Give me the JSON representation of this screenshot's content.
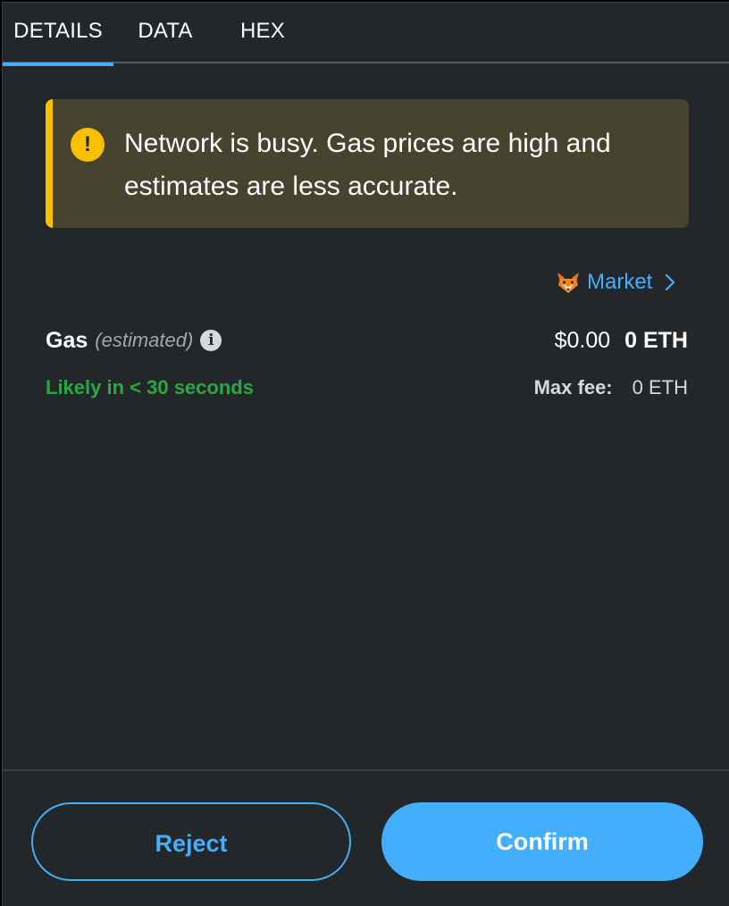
{
  "tabs": [
    {
      "label": "DETAILS",
      "active": true
    },
    {
      "label": "DATA",
      "active": false
    },
    {
      "label": "HEX",
      "active": false
    }
  ],
  "warning": {
    "icon": "exclamation-icon",
    "icon_glyph": "!",
    "text": "Network is busy. Gas prices are high and estimates are less accurate."
  },
  "market": {
    "icon": "fox-icon",
    "label": "Market"
  },
  "gas": {
    "label": "Gas",
    "sub_label": "(estimated)",
    "info_glyph": "i",
    "fiat": "$0.00",
    "eth": "0 ETH",
    "likely": "Likely in < 30 seconds",
    "max_fee_label": "Max fee:",
    "max_fee_value": "0 ETH"
  },
  "footer": {
    "reject_label": "Reject",
    "confirm_label": "Confirm"
  },
  "colors": {
    "background": "#24272a",
    "accent": "#43aefc",
    "warning": "#f8c000",
    "success": "#28a745"
  }
}
